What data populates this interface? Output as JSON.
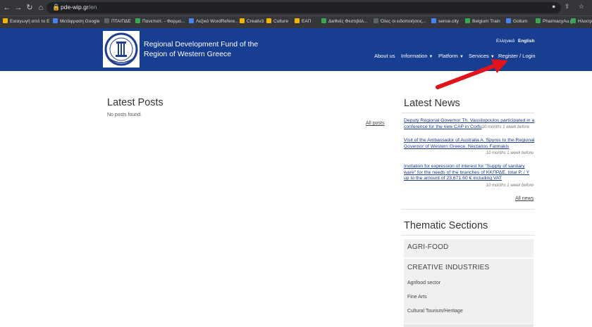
{
  "browser": {
    "url_host": "pde-wip.gr",
    "url_path": "/en",
    "bookmarks": [
      {
        "label": "Εισαγωγή από το E",
        "color": "#f4b400"
      },
      {
        "label": "Μετάφραση Google",
        "color": "#4285f4"
      },
      {
        "label": "ΠΤΑ/ΠΔΕ",
        "color": "#5f6368"
      },
      {
        "label": "Πανεπιστ. - Φαρμα...",
        "color": "#34a853"
      },
      {
        "label": "Λεξικό WordRefere...",
        "color": "#4285f4"
      },
      {
        "label": "Creativ3",
        "color": "#f4b400"
      },
      {
        "label": "Culture",
        "color": "#f4b400"
      },
      {
        "label": "ΕΑΠ",
        "color": "#f4b400"
      },
      {
        "label": "Διεθνές Φεστιβάλ...",
        "color": "#34a853"
      },
      {
        "label": "Όλες οι ειδοποιήσεις...",
        "color": "#5f6368"
      },
      {
        "label": "sense.city",
        "color": "#4285f4"
      },
      {
        "label": "Belgium Train",
        "color": "#34a853"
      },
      {
        "label": "Gollum",
        "color": "#4285f4"
      },
      {
        "label": "PharmacyAu.gr",
        "color": "#34a853"
      },
      {
        "label": "Ηλεκτρονικό Διακυ...",
        "color": "#34a853"
      }
    ]
  },
  "header": {
    "title_line1": "Regional Development Fund of the",
    "title_line2": "Region of Western Greece",
    "lang_el": "Ελληνικά",
    "lang_en": "English",
    "nav": {
      "about": "About us",
      "information": "Information",
      "platform": "Platform",
      "services": "Services",
      "register": "Register / Login"
    },
    "caret": "▼"
  },
  "main": {
    "posts_title": "Latest Posts",
    "no_posts": "No posts found.",
    "all_posts": "All posts"
  },
  "sidebar": {
    "news_title": "Latest News",
    "news": [
      {
        "title": "Deputy Regional Governor Th. Vassilopoulos participated in a conference for the new CAP in Corfu",
        "when": "10 months 1 week before"
      },
      {
        "title": "Visit of the Ambassador of Australia A. Spyros to the Regional Governor of Western Greece, Nectarios Farmakis",
        "when": "10 months 1 week before"
      },
      {
        "title": "Invitation for expression of interest for \"Supply of sanitary ware\" for the needs of the branches of ΚΚΠΡΔΕ, total P. / Y up to the amount of 23,671.60 € including VAT",
        "when": "10 months 1 week before"
      }
    ],
    "all_news": "All news",
    "thematic_title": "Thematic Sections",
    "sections": {
      "agri": "AGRI-FOOD",
      "creative": "CREATIVE INDUSTRIES",
      "sub": [
        "Agrifood sector",
        "Fine Arts",
        "Cultural Tourism/Heritage"
      ]
    }
  },
  "colors": {
    "header_bg": "#173e91",
    "link": "#1a3a8a",
    "arrow": "#e0141a"
  }
}
